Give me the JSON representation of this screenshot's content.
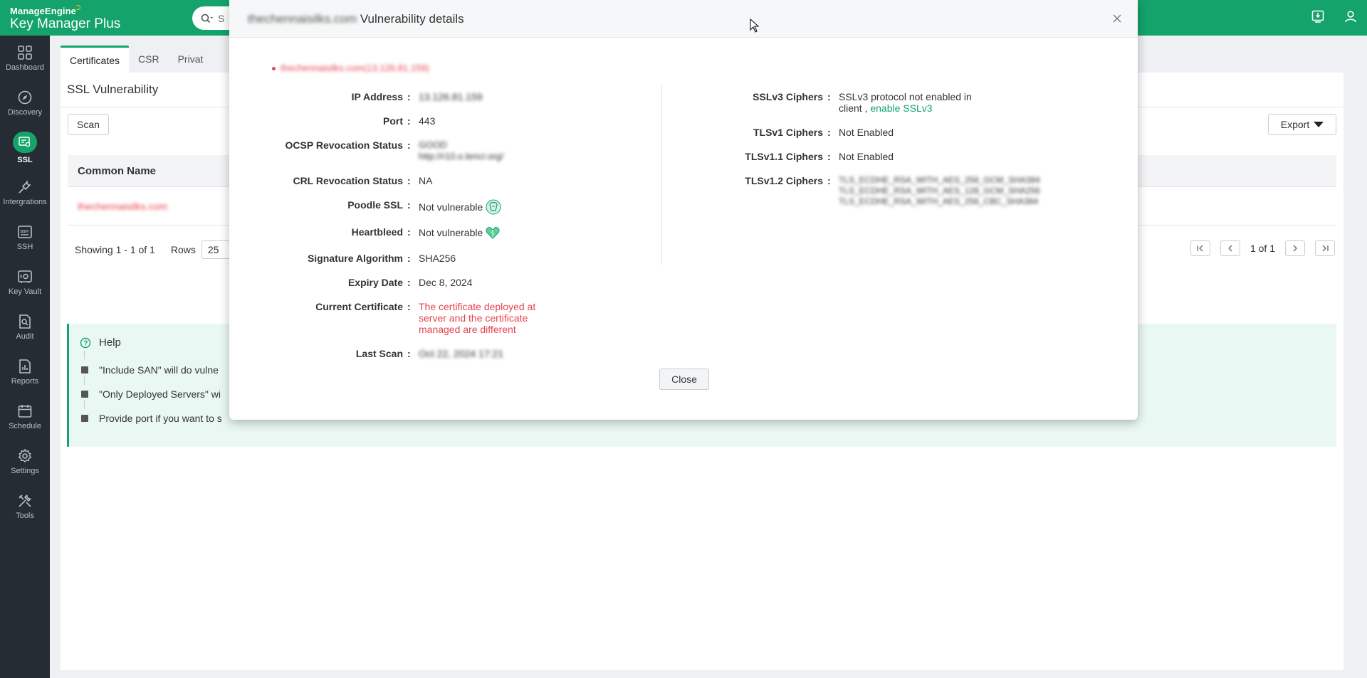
{
  "app": {
    "brand_top": "ManageEngine",
    "brand_name": "Key Manager",
    "brand_suffix": "Plus",
    "search_placeholder": "S"
  },
  "sidebar": {
    "items": [
      {
        "label": "Dashboard",
        "icon": "dashboard-icon"
      },
      {
        "label": "Discovery",
        "icon": "compass-icon"
      },
      {
        "label": "SSL",
        "icon": "certificate-icon",
        "active": true
      },
      {
        "label": "Intergrations",
        "icon": "plug-icon"
      },
      {
        "label": "SSH",
        "icon": "ssh-icon"
      },
      {
        "label": "Key Vault",
        "icon": "vault-icon"
      },
      {
        "label": "Audit",
        "icon": "audit-icon"
      },
      {
        "label": "Reports",
        "icon": "reports-icon"
      },
      {
        "label": "Schedule",
        "icon": "calendar-icon"
      },
      {
        "label": "Settings",
        "icon": "gear-icon"
      },
      {
        "label": "Tools",
        "icon": "tools-icon"
      }
    ]
  },
  "tabs": [
    {
      "label": "Certificates",
      "active": true
    },
    {
      "label": "CSR"
    },
    {
      "label": "Privat"
    }
  ],
  "page": {
    "title": "SSL Vulnerability",
    "scan_label": "Scan",
    "export_label": "Export",
    "table_header": "Common Name",
    "row_common_name": "thechennaisilks.com",
    "showing": "Showing 1 - 1 of 1",
    "rows_label": "Rows",
    "rows_value": "25",
    "page_info": "1 of 1"
  },
  "help": {
    "title": "Help",
    "items": [
      "\"Include SAN\" will do vulne",
      "\"Only Deployed Servers\" wi",
      "Provide port if you want to s"
    ]
  },
  "modal": {
    "title_host": "thechennaisilks.com",
    "title_suffix": "Vulnerability details",
    "host_link": "thechennaisilks.com",
    "host_ip": "(13.126.81.159)",
    "left": {
      "ip_label": "IP Address",
      "ip_value": "13.126.81.159",
      "port_label": "Port",
      "port_value": "443",
      "ocsp_label": "OCSP Revocation Status",
      "ocsp_value_1": "GOOD",
      "ocsp_value_2": "http://r10.o.lencr.org/",
      "crl_label": "CRL Revocation Status",
      "crl_value": "NA",
      "poodle_label": "Poodle SSL",
      "poodle_value": "Not vulnerable",
      "heartbleed_label": "Heartbleed",
      "heartbleed_value": "Not vulnerable",
      "sigalg_label": "Signature Algorithm",
      "sigalg_value": "SHA256",
      "expiry_label": "Expiry Date",
      "expiry_value": "Dec 8, 2024",
      "current_label": "Current Certificate",
      "current_value_1": "The certificate deployed at",
      "current_value_2": "server and the certificate",
      "current_value_3": "managed are different",
      "lastscan_label": "Last Scan",
      "lastscan_value": "Oct 22, 2024 17:21"
    },
    "right": {
      "sslv3_label": "SSLv3 Ciphers",
      "sslv3_value_1": "SSLv3 protocol not enabled in",
      "sslv3_value_2": "client ,",
      "sslv3_link": "enable SSLv3",
      "tlsv1_label": "TLSv1 Ciphers",
      "tlsv1_value": "Not Enabled",
      "tlsv11_label": "TLSv1.1 Ciphers",
      "tlsv11_value": "Not Enabled",
      "tlsv12_label": "TLSv1.2 Ciphers",
      "tlsv12_value_1": "TLS_ECDHE_RSA_WITH_AES_256_GCM_SHA384",
      "tlsv12_value_2": "TLS_ECDHE_RSA_WITH_AES_128_GCM_SHA256",
      "tlsv12_value_3": "TLS_ECDHE_RSA_WITH_AES_256_CBC_SHA384"
    },
    "close_label": "Close"
  },
  "colors": {
    "brand_green": "#14a36a",
    "sidebar_bg": "#252c33",
    "error_red": "#e6434f"
  }
}
